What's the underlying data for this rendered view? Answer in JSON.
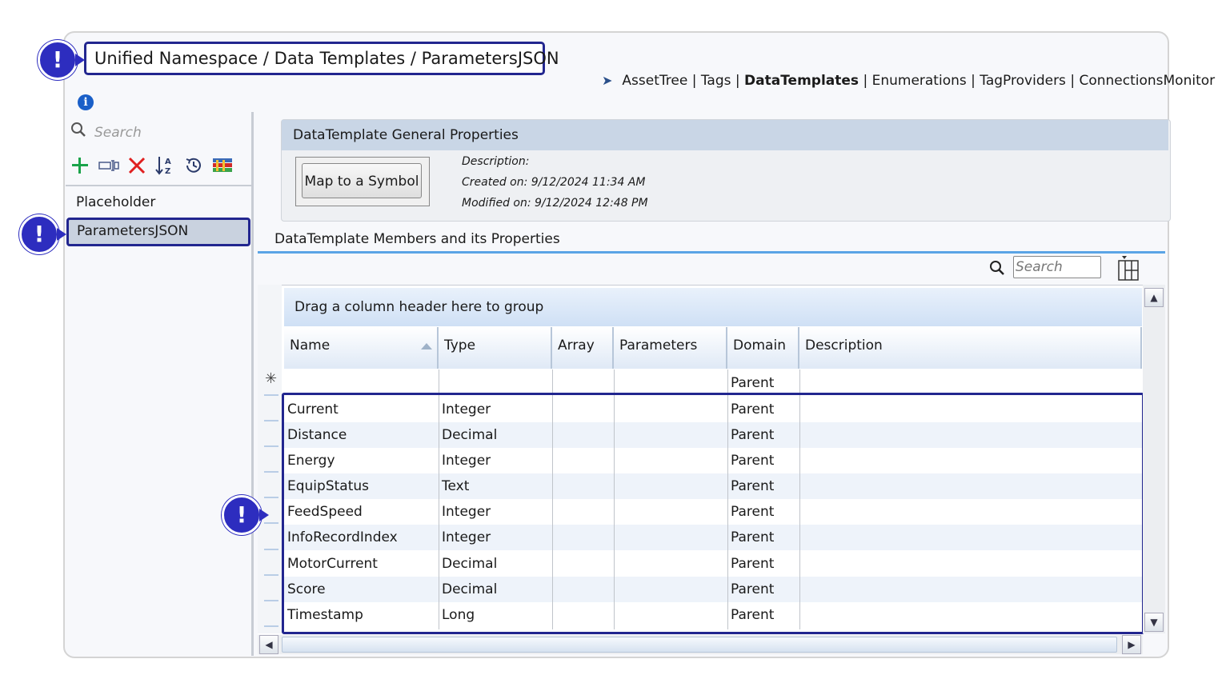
{
  "breadcrumb": "Unified Namespace / Data Templates / ParametersJSON",
  "nav": {
    "items": [
      "AssetTree",
      "Tags",
      "DataTemplates",
      "Enumerations",
      "TagProviders",
      "ConnectionsMonitor"
    ],
    "active": "DataTemplates",
    "separator": "|"
  },
  "markers": {
    "glyph": "!"
  },
  "sidebar": {
    "search_placeholder": "Search",
    "toolbar_icons": [
      "add-icon",
      "rename-icon",
      "delete-icon",
      "sort-az-icon",
      "history-icon",
      "library-icon"
    ],
    "items": [
      {
        "label": "Placeholder",
        "selected": false
      },
      {
        "label": "ParametersJSON",
        "selected": true
      }
    ]
  },
  "general": {
    "title": "DataTemplate General Properties",
    "map_button": "Map to a Symbol",
    "description": "Description:",
    "created": "Created on: 9/12/2024 11:34 AM",
    "modified": "Modified on: 9/12/2024 12:48 PM"
  },
  "members": {
    "title": "DataTemplate Members and its Properties",
    "search_placeholder": "Search",
    "group_prompt": "Drag a column header here to group",
    "columns": [
      "Name",
      "Type",
      "Array",
      "Parameters",
      "Domain",
      "Description"
    ],
    "new_row_domain": "Parent",
    "rows": [
      {
        "name": "Current",
        "type": "Integer",
        "array": "",
        "parameters": "",
        "domain": "Parent",
        "description": ""
      },
      {
        "name": "Distance",
        "type": "Decimal",
        "array": "",
        "parameters": "",
        "domain": "Parent",
        "description": ""
      },
      {
        "name": "Energy",
        "type": "Integer",
        "array": "",
        "parameters": "",
        "domain": "Parent",
        "description": ""
      },
      {
        "name": "EquipStatus",
        "type": "Text",
        "array": "",
        "parameters": "",
        "domain": "Parent",
        "description": ""
      },
      {
        "name": "FeedSpeed",
        "type": "Integer",
        "array": "",
        "parameters": "",
        "domain": "Parent",
        "description": ""
      },
      {
        "name": "InfoRecordIndex",
        "type": "Integer",
        "array": "",
        "parameters": "",
        "domain": "Parent",
        "description": ""
      },
      {
        "name": "MotorCurrent",
        "type": "Decimal",
        "array": "",
        "parameters": "",
        "domain": "Parent",
        "description": ""
      },
      {
        "name": "Score",
        "type": "Decimal",
        "array": "",
        "parameters": "",
        "domain": "Parent",
        "description": ""
      },
      {
        "name": "Timestamp",
        "type": "Long",
        "array": "",
        "parameters": "",
        "domain": "Parent",
        "description": ""
      }
    ]
  },
  "colors": {
    "accent_outline": "#22268f",
    "marker": "#2d2dbf",
    "header_blue": "#c9d6e6",
    "members_line": "#5aa4e6"
  }
}
